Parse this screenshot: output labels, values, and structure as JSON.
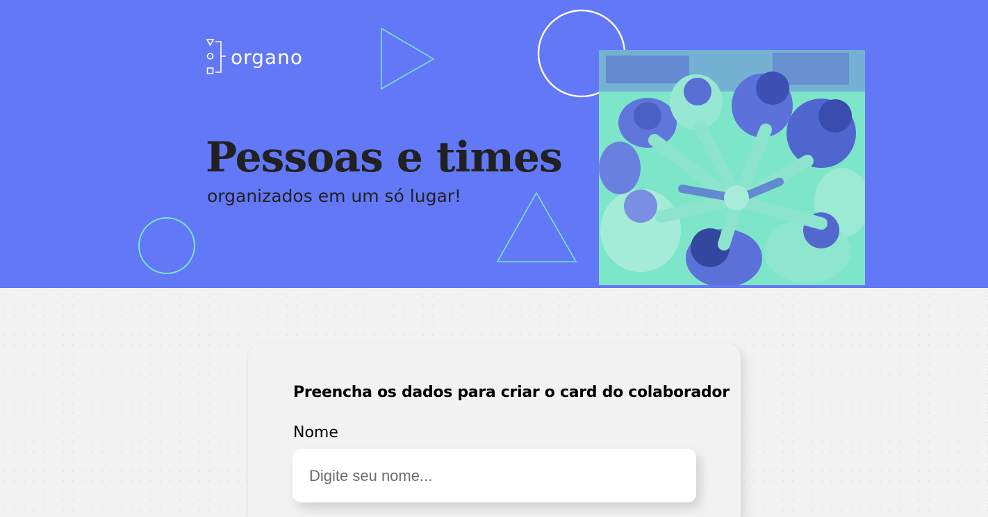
{
  "banner": {
    "logo_text": "organo",
    "headline": "Pessoas e times",
    "subheadline": "organizados em um só lugar!",
    "hero_image_alt": "Equipe com as mãos unidas no centro",
    "colors": {
      "background": "#6278f7",
      "accent": "#77e7c7",
      "text": "#212121"
    }
  },
  "form": {
    "title": "Preencha os dados para criar o card do colaborador",
    "fields": [
      {
        "label": "Nome",
        "placeholder": "Digite seu nome..."
      }
    ]
  }
}
